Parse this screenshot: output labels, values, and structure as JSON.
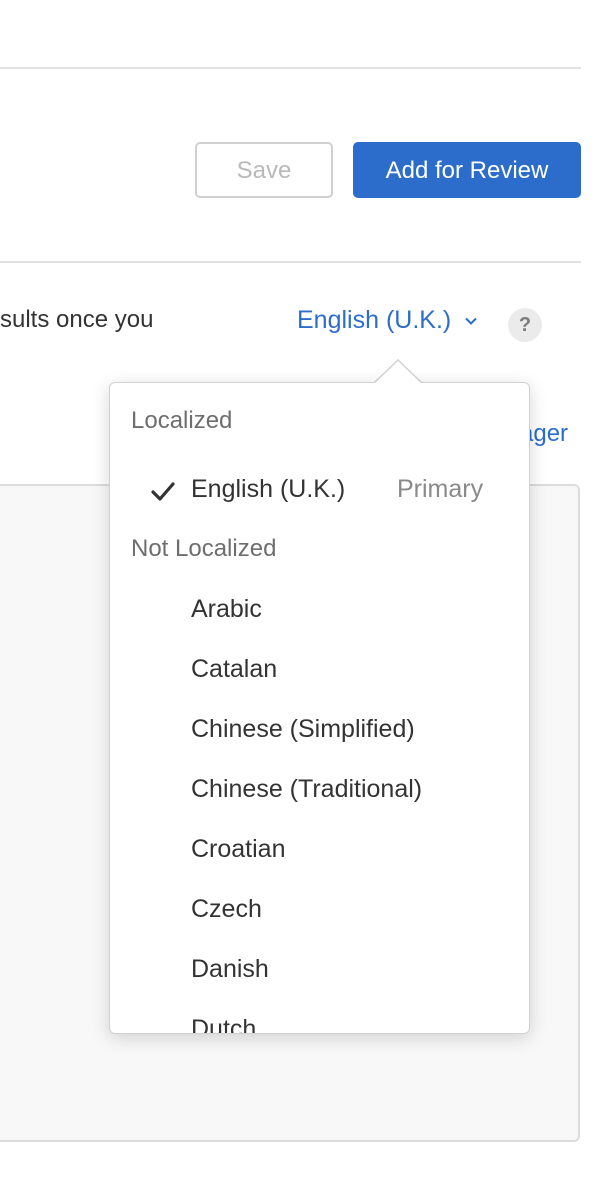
{
  "toolbar": {
    "save_label": "Save",
    "add_for_review_label": "Add for Review"
  },
  "main": {
    "body_text": "sults once you",
    "manager_link": "ager",
    "help_label": "?"
  },
  "language_selector": {
    "selected": "English (U.K.)",
    "chevron_icon": "chevron-down-icon"
  },
  "popover": {
    "localized_heading": "Localized",
    "localized": [
      {
        "label": "English (U.K.)",
        "tag": "Primary",
        "checked": true
      }
    ],
    "not_localized_heading": "Not Localized",
    "not_localized": [
      {
        "label": "Arabic"
      },
      {
        "label": "Catalan"
      },
      {
        "label": "Chinese (Simplified)"
      },
      {
        "label": "Chinese (Traditional)"
      },
      {
        "label": "Croatian"
      },
      {
        "label": "Czech"
      },
      {
        "label": "Danish"
      },
      {
        "label": "Dutch"
      }
    ]
  },
  "colors": {
    "accent": "#2c6dcb",
    "divider": "#e2e2e2",
    "panel_bg": "#f8f8f8"
  }
}
